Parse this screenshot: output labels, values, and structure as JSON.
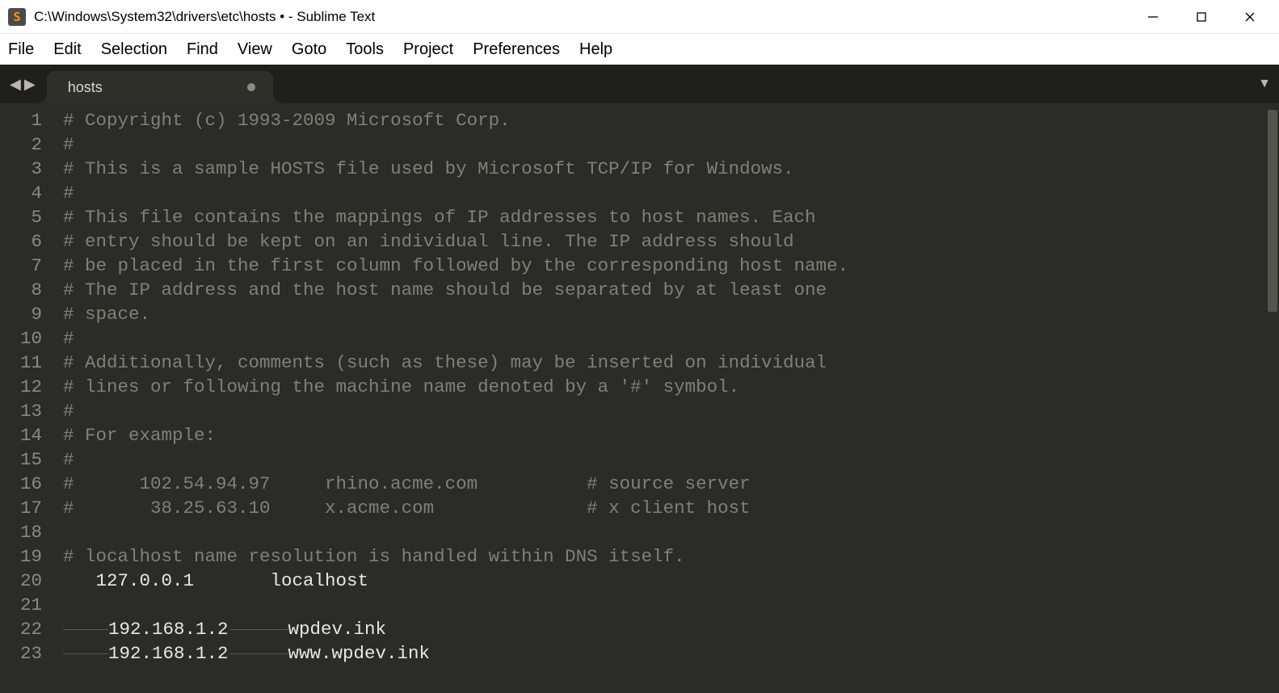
{
  "titlebar": {
    "path": "C:\\Windows\\System32\\drivers\\etc\\hosts • - Sublime Text"
  },
  "menubar": {
    "items": [
      "File",
      "Edit",
      "Selection",
      "Find",
      "View",
      "Goto",
      "Tools",
      "Project",
      "Preferences",
      "Help"
    ]
  },
  "tabs": {
    "active": {
      "label": "hosts",
      "dirty": true
    }
  },
  "editor": {
    "lines": [
      {
        "n": 1,
        "kind": "comment",
        "text": "# Copyright (c) 1993-2009 Microsoft Corp."
      },
      {
        "n": 2,
        "kind": "comment",
        "text": "#"
      },
      {
        "n": 3,
        "kind": "comment",
        "text": "# This is a sample HOSTS file used by Microsoft TCP/IP for Windows."
      },
      {
        "n": 4,
        "kind": "comment",
        "text": "#"
      },
      {
        "n": 5,
        "kind": "comment",
        "text": "# This file contains the mappings of IP addresses to host names. Each"
      },
      {
        "n": 6,
        "kind": "comment",
        "text": "# entry should be kept on an individual line. The IP address should"
      },
      {
        "n": 7,
        "kind": "comment",
        "text": "# be placed in the first column followed by the corresponding host name."
      },
      {
        "n": 8,
        "kind": "comment",
        "text": "# The IP address and the host name should be separated by at least one"
      },
      {
        "n": 9,
        "kind": "comment",
        "text": "# space."
      },
      {
        "n": 10,
        "kind": "comment",
        "text": "#"
      },
      {
        "n": 11,
        "kind": "comment",
        "text": "# Additionally, comments (such as these) may be inserted on individual"
      },
      {
        "n": 12,
        "kind": "comment",
        "text": "# lines or following the machine name denoted by a '#' symbol."
      },
      {
        "n": 13,
        "kind": "comment",
        "text": "#"
      },
      {
        "n": 14,
        "kind": "comment",
        "text": "# For example:"
      },
      {
        "n": 15,
        "kind": "comment",
        "text": "#"
      },
      {
        "n": 16,
        "kind": "comment",
        "text": "#      102.54.94.97     rhino.acme.com          # source server"
      },
      {
        "n": 17,
        "kind": "comment",
        "text": "#       38.25.63.10     x.acme.com              # x client host"
      },
      {
        "n": 18,
        "kind": "blank",
        "text": ""
      },
      {
        "n": 19,
        "kind": "comment",
        "text": "# localhost name resolution is handled within DNS itself."
      },
      {
        "n": 20,
        "kind": "code",
        "text": "   127.0.0.1       localhost"
      },
      {
        "n": 21,
        "kind": "blank",
        "text": ""
      },
      {
        "n": 22,
        "kind": "whitespace-entry",
        "ip": "192.168.1.2",
        "host": "wpdev.ink",
        "cursor": true
      },
      {
        "n": 23,
        "kind": "whitespace-entry",
        "ip": "192.168.1.2",
        "host": "www.wpdev.ink"
      }
    ]
  }
}
